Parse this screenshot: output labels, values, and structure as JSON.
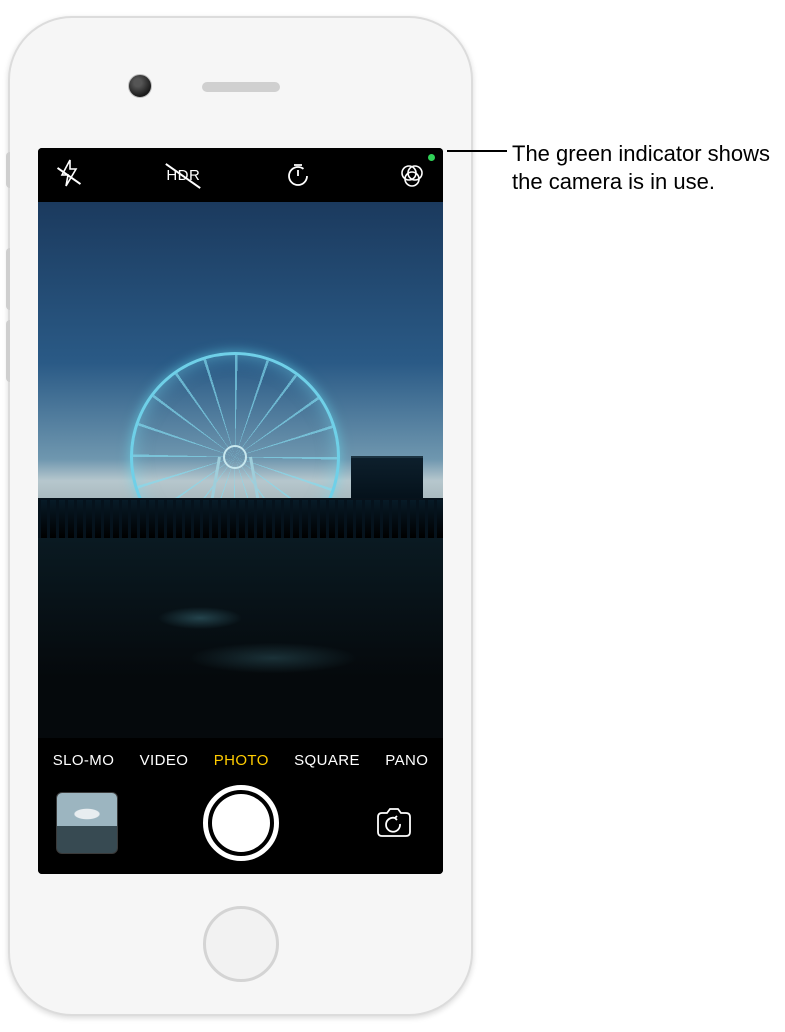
{
  "callout": "The green indicator shows the camera is in use.",
  "topbar": {
    "flash": "flash-off",
    "hdr": "HDR",
    "timer": "timer",
    "filters": "filters"
  },
  "modes": [
    {
      "label": "SLO-MO",
      "active": false
    },
    {
      "label": "VIDEO",
      "active": false
    },
    {
      "label": "PHOTO",
      "active": true
    },
    {
      "label": "SQUARE",
      "active": false
    },
    {
      "label": "PANO",
      "active": false
    }
  ],
  "bottom": {
    "shutter": "take-photo",
    "switch": "switch-camera",
    "thumbnail": "last-photo-thumbnail"
  }
}
